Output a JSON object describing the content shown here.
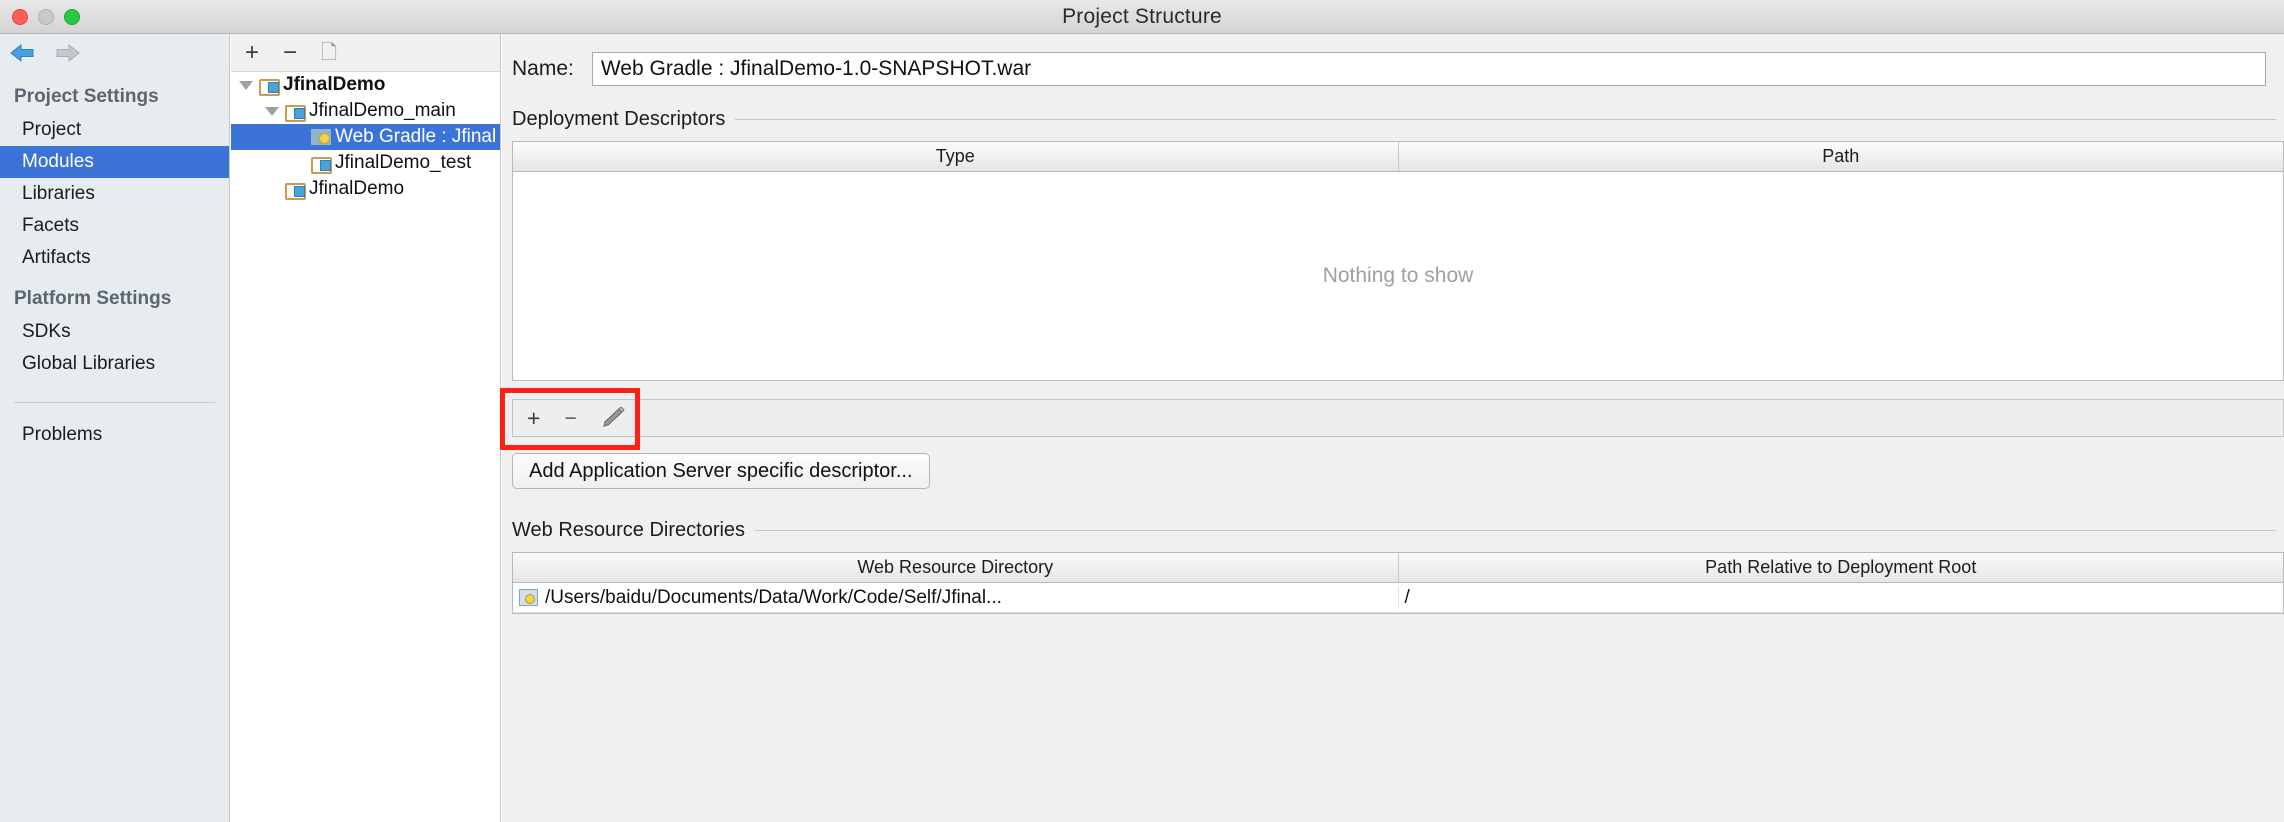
{
  "window": {
    "title": "Project Structure",
    "traffic_lights": [
      "close-dot",
      "minimize-dot",
      "zoom-dot"
    ]
  },
  "sidebar": {
    "back_icon": "back-arrow-icon",
    "forward_icon": "forward-arrow-icon",
    "sections": [
      {
        "header": "Project Settings",
        "items": [
          {
            "label": "Project",
            "selected": false
          },
          {
            "label": "Modules",
            "selected": true
          },
          {
            "label": "Libraries",
            "selected": false
          },
          {
            "label": "Facets",
            "selected": false
          },
          {
            "label": "Artifacts",
            "selected": false
          }
        ]
      },
      {
        "header": "Platform Settings",
        "items": [
          {
            "label": "SDKs",
            "selected": false
          },
          {
            "label": "Global Libraries",
            "selected": false
          }
        ]
      }
    ],
    "problems": {
      "label": "Problems"
    }
  },
  "tree": {
    "toolbar": {
      "add": "+",
      "remove": "−",
      "copy_icon": "copy-icon"
    },
    "nodes": [
      {
        "label": "JfinalDemo",
        "indent": 0,
        "twisty": "expanded",
        "icon": "module-folder-icon",
        "bold": true,
        "selected": false
      },
      {
        "label": "JfinalDemo_main",
        "indent": 1,
        "twisty": "expanded",
        "icon": "module-folder-icon",
        "bold": false,
        "selected": false
      },
      {
        "label": "Web Gradle : Jfinal",
        "indent": 2,
        "twisty": "none",
        "icon": "war-facet-icon",
        "bold": false,
        "selected": true
      },
      {
        "label": "JfinalDemo_test",
        "indent": 1,
        "twisty": "none",
        "icon": "module-folder-icon",
        "bold": false,
        "selected": false
      },
      {
        "label": "JfinalDemo",
        "indent": 0,
        "twisty": "none",
        "icon": "module-folder-icon",
        "bold": false,
        "selected": false
      }
    ]
  },
  "main": {
    "name_field": {
      "label": "Name:",
      "value": "Web Gradle : JfinalDemo-1.0-SNAPSHOT.war",
      "placeholder": ""
    },
    "deployment_descriptors": {
      "title": "Deployment Descriptors",
      "columns": [
        "Type",
        "Path"
      ],
      "rows": [],
      "empty_text": "Nothing to show",
      "toolbar": {
        "add": "+",
        "remove": "−",
        "edit_icon": "pencil-icon",
        "highlight_color": "#ff2116"
      },
      "add_descriptor_button": "Add Application Server specific descriptor..."
    },
    "web_resource_directories": {
      "title": "Web Resource Directories",
      "columns": [
        "Web Resource Directory",
        "Path Relative to Deployment Root"
      ],
      "rows": [
        {
          "icon": "directory-icon",
          "directory": "/Users/baidu/Documents/Data/Work/Code/Self/Jfinal...",
          "relative_path": "/"
        }
      ]
    }
  },
  "colors": {
    "selection_blue": "#3b73d6",
    "highlight_red": "#ff2116",
    "sidebar_bg": "#e7ecef",
    "panel_bg": "#f0f0f0"
  }
}
